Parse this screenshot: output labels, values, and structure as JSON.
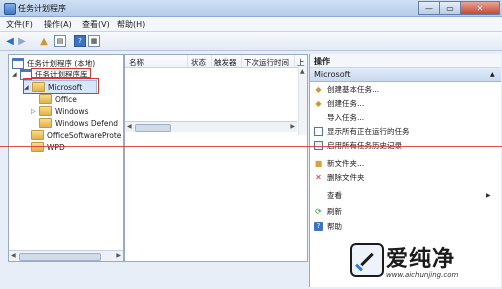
{
  "window": {
    "title": "任务计划程序",
    "controls": {
      "minimize": "—",
      "maximize": "▭",
      "close": "✕"
    }
  },
  "menubar": {
    "items": [
      "文件(F)",
      "操作(A)",
      "查看(V)",
      "帮助(H)"
    ]
  },
  "toolbar": {
    "icons": [
      "back-arrow-icon",
      "forward-arrow-icon",
      "folder-up-icon",
      "show-hide-tree-icon",
      "help-icon",
      "properties-icon"
    ]
  },
  "tree": {
    "root": "任务计划程序 (本地)",
    "library": "任务计划程序库",
    "items": [
      "Microsoft",
      "Office",
      "Windows",
      "Windows Defend",
      "OfficeSoftwareProte",
      "WPD"
    ]
  },
  "task_list": {
    "columns": [
      "名称",
      "状态",
      "触发器",
      "下次运行时间",
      "上"
    ]
  },
  "actions_pane": {
    "title": "操作",
    "section": "Microsoft",
    "items": [
      {
        "label": "创建基本任务...",
        "icon": "create-basic-task-icon"
      },
      {
        "label": "创建任务...",
        "icon": "create-task-icon"
      },
      {
        "label": "导入任务...",
        "icon": "import-task-icon"
      },
      {
        "label": "显示所有正在运行的任务",
        "icon": "running-tasks-icon"
      },
      {
        "label": "启用所有任务历史记录",
        "icon": "history-icon"
      },
      {
        "label": "新文件夹...",
        "icon": "new-folder-icon"
      },
      {
        "label": "删除文件夹",
        "icon": "delete-icon"
      },
      {
        "label": "查看",
        "icon": ""
      },
      {
        "label": "刷新",
        "icon": "refresh-icon"
      },
      {
        "label": "帮助",
        "icon": "help-icon"
      }
    ]
  },
  "watermark": {
    "text": "爱纯净",
    "url": "www.aichunjing.com"
  }
}
